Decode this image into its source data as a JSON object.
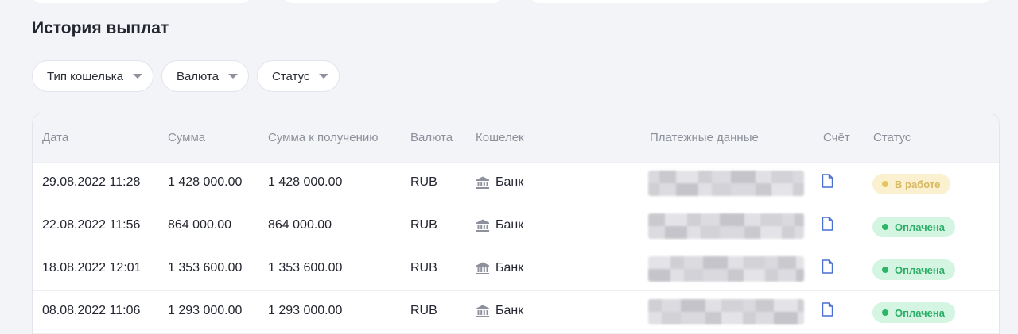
{
  "header": {
    "title": "История выплат"
  },
  "filters": [
    {
      "label": "Тип кошелька"
    },
    {
      "label": "Валюта"
    },
    {
      "label": "Статус"
    }
  ],
  "table": {
    "columns": {
      "date": "Дата",
      "amount": "Сумма",
      "amount_received": "Сумма к получению",
      "currency": "Валюта",
      "wallet": "Кошелек",
      "payment_data": "Платежные данные",
      "invoice": "Счёт",
      "status": "Статус"
    },
    "rows": [
      {
        "date": "29.08.2022 11:28",
        "amount": "1 428 000.00",
        "amount_received": "1 428 000.00",
        "currency": "RUB",
        "wallet": "Банк",
        "status": "В работе",
        "status_type": "work"
      },
      {
        "date": "22.08.2022 11:56",
        "amount": "864 000.00",
        "amount_received": "864 000.00",
        "currency": "RUB",
        "wallet": "Банк",
        "status": "Оплачена",
        "status_type": "paid"
      },
      {
        "date": "18.08.2022 12:01",
        "amount": "1 353 600.00",
        "amount_received": "1 353 600.00",
        "currency": "RUB",
        "wallet": "Банк",
        "status": "Оплачена",
        "status_type": "paid"
      },
      {
        "date": "08.08.2022 11:06",
        "amount": "1 293 000.00",
        "amount_received": "1 293 000.00",
        "currency": "RUB",
        "wallet": "Банк",
        "status": "Оплачена",
        "status_type": "paid"
      }
    ]
  },
  "icons": {
    "wallet": "bank-icon",
    "invoice": "document-icon",
    "filter_caret": "caret-down-icon"
  },
  "colors": {
    "status_work": "#e6c55f",
    "status_paid": "#2bb567",
    "icon_accent": "#4a6fd1"
  }
}
